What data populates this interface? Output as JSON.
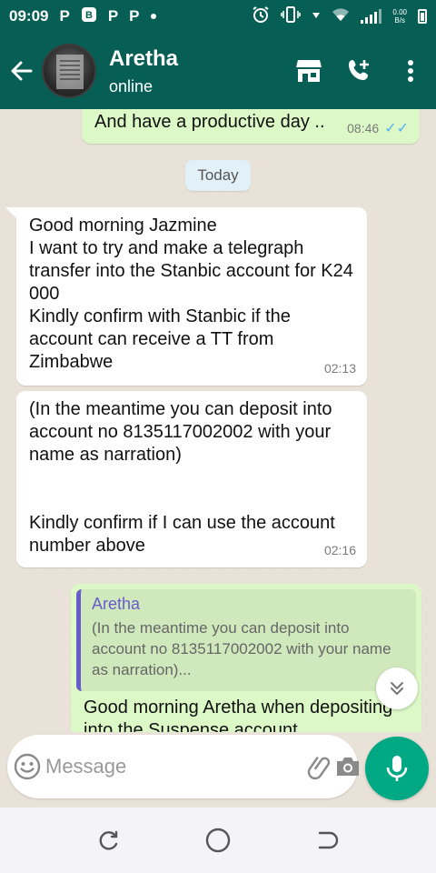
{
  "status_bar": {
    "time": "09:09",
    "icons": [
      "p-icon",
      "b-icon",
      "p-icon",
      "p-icon",
      "dot-icon"
    ],
    "network_speed_value": "0.00",
    "network_speed_unit": "B/s"
  },
  "header": {
    "contact_name": "Aretha",
    "contact_status": "online",
    "actions": [
      "store-icon",
      "add-call-icon",
      "more-icon"
    ]
  },
  "chat": {
    "previous_message": {
      "text": "And have a productive day ..",
      "time": "08:46",
      "status": "read"
    },
    "date_divider": "Today",
    "messages": [
      {
        "direction": "incoming",
        "text": "Good morning Jazmine\nI want to try and make a telegraph transfer into the Stanbic account for K24 000\nKindly confirm with Stanbic if the account can receive a TT from Zimbabwe",
        "time": "02:13"
      },
      {
        "direction": "incoming",
        "text": "(In the meantime you can deposit into account no 8135117002002 with your name as narration)\n\n\nKindly confirm if I can use the account number above",
        "time": "02:16"
      },
      {
        "direction": "outgoing",
        "quote_author": "Aretha",
        "quote_text": "(In the meantime you can deposit into account no 8135117002002 with your name as narration)...",
        "text": "Good morning Aretha when depositing into the Suspense account"
      }
    ]
  },
  "composer": {
    "placeholder": "Message",
    "value": ""
  },
  "colors": {
    "header": "#075e54",
    "accent": "#00a884",
    "outgoing_bubble": "#dcf8c6",
    "incoming_bubble": "#ffffff",
    "quote_author": "#6a5bcd",
    "read_ticks": "#4fb3f5"
  },
  "nav": [
    "recents-icon",
    "home-icon",
    "back-icon"
  ]
}
